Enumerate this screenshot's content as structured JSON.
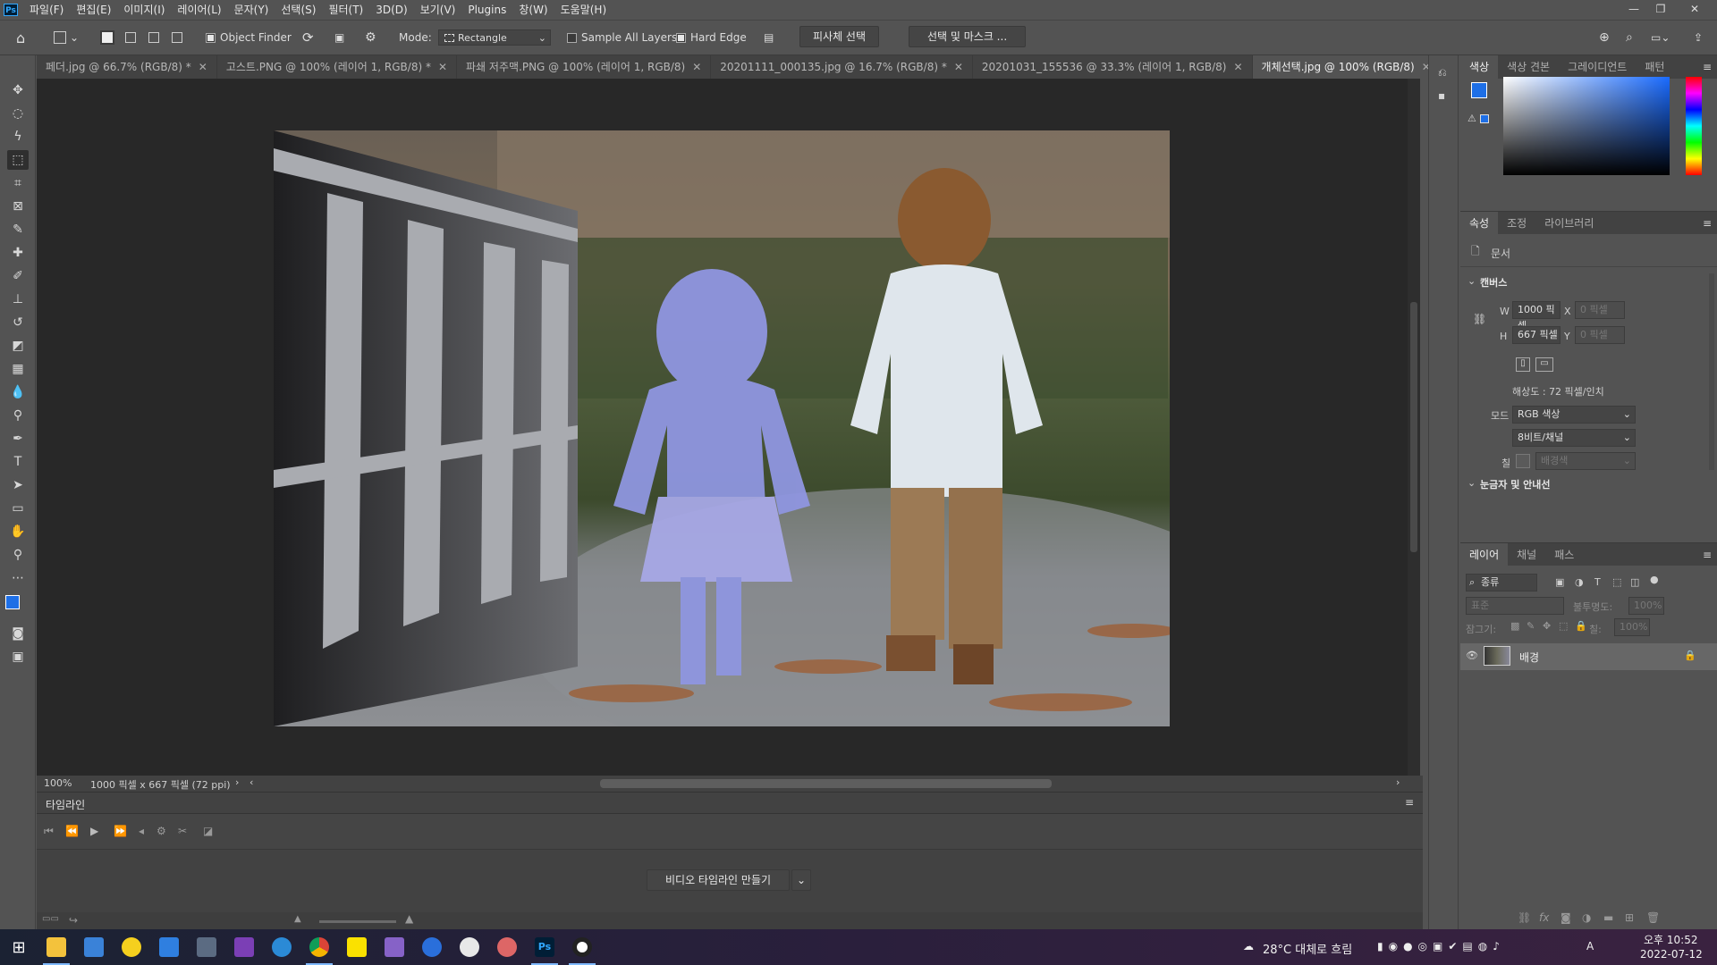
{
  "app": {
    "logo": "Ps"
  },
  "menu": [
    "파일(F)",
    "편집(E)",
    "이미지(I)",
    "레이어(L)",
    "문자(Y)",
    "선택(S)",
    "필터(T)",
    "3D(D)",
    "보기(V)",
    "Plugins",
    "창(W)",
    "도움말(H)"
  ],
  "window_controls": {
    "minimize": "—",
    "restore": "❐",
    "close": "✕"
  },
  "options": {
    "object_finder": "Object Finder",
    "mode_label": "Mode:",
    "mode_value": "Rectangle",
    "sample_all_layers": "Sample All Layers",
    "hard_edge": "Hard Edge",
    "select_subject": "피사체 선택",
    "select_and_mask": "선택 및 마스크 ..."
  },
  "tabs": [
    {
      "label": "페더.jpg @ 66.7% (RGB/8) *"
    },
    {
      "label": "고스트.PNG @ 100% (레이어 1, RGB/8) *"
    },
    {
      "label": "파쇄 저주맥.PNG @ 100% (레이어 1, RGB/8)"
    },
    {
      "label": "20201111_000135.jpg @ 16.7% (RGB/8) *"
    },
    {
      "label": "20201031_155536 @ 33.3% (레이어 1, RGB/8)"
    },
    {
      "label": "개체선택.jpg @ 100% (RGB/8)"
    }
  ],
  "status": {
    "zoom": "100%",
    "doc_info": "1000 픽셀 x 667 픽셀 (72 ppi)"
  },
  "timeline": {
    "title": "타임라인",
    "create_button": "비디오 타임라인 만들기"
  },
  "color_panel": {
    "tabs": [
      "색상",
      "색상 견본",
      "그레이디언트",
      "패턴"
    ],
    "fg": "#1e6fe6",
    "bg": "#ffffff"
  },
  "properties": {
    "tabs": [
      "속성",
      "조정",
      "라이브러리"
    ],
    "doc_label": "문서",
    "canvas_section": "캔버스",
    "w_label": "W",
    "w_value": "1000 픽셀",
    "h_label": "H",
    "h_value": "667 픽셀",
    "x_label": "X",
    "x_value": "0 픽셀",
    "y_label": "Y",
    "y_value": "0 픽셀",
    "resolution": "해상도 : 72 픽셀/인치",
    "mode_label": "모드",
    "mode_value": "RGB 색상",
    "depth_value": "8비트/채널",
    "fill_label": "칠",
    "fill_value": "배경색",
    "rulers_section": "눈금자 및 안내선"
  },
  "layers": {
    "tabs": [
      "레이어",
      "채널",
      "패스"
    ],
    "search": "종류",
    "blend": "표준",
    "opacity_label": "불투명도:",
    "opacity_value": "100%",
    "lock_label": "잠그기:",
    "fill_label": "칠:",
    "fill_value": "100%",
    "items": [
      {
        "name": "배경"
      }
    ]
  },
  "taskbar": {
    "weather": "28°C 대체로 흐림",
    "time": "오후 10:52",
    "date": "2022-07-12"
  }
}
